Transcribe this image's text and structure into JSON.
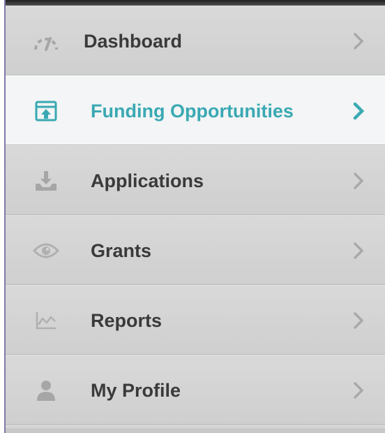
{
  "menu": {
    "items": [
      {
        "label": "Dashboard",
        "icon": "gauge-icon",
        "active": false
      },
      {
        "label": "Funding Opportunities",
        "icon": "upload-box-icon",
        "active": true
      },
      {
        "label": "Applications",
        "icon": "download-tray-icon",
        "active": false
      },
      {
        "label": "Grants",
        "icon": "eye-icon",
        "active": false
      },
      {
        "label": "Reports",
        "icon": "line-chart-icon",
        "active": false
      },
      {
        "label": "My Profile",
        "icon": "user-icon",
        "active": false
      }
    ]
  },
  "colors": {
    "accent": "#3aa9b3",
    "text": "#3a3a3a",
    "item_bg": "#d6d6d6",
    "active_bg": "#f3f5f6",
    "muted_icon": "#a6a6a6"
  }
}
